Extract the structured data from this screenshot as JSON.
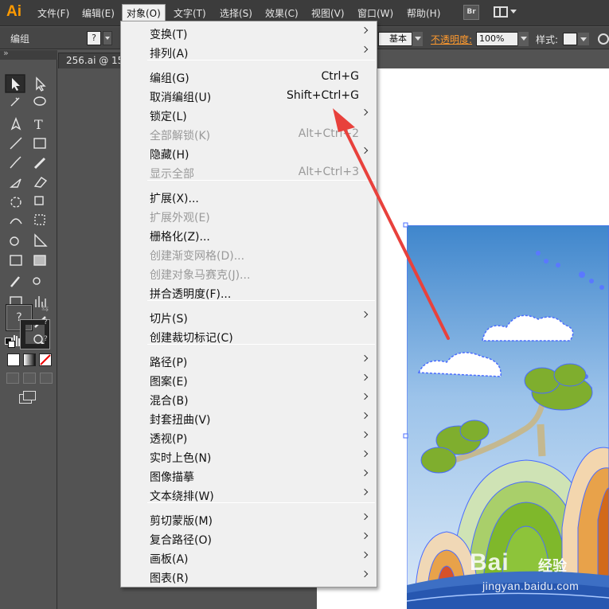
{
  "app": {
    "logo": "Ai"
  },
  "menubar": {
    "items": [
      {
        "label": "文件(F)"
      },
      {
        "label": "编辑(E)"
      },
      {
        "label": "对象(O)"
      },
      {
        "label": "文字(T)"
      },
      {
        "label": "选择(S)"
      },
      {
        "label": "效果(C)"
      },
      {
        "label": "视图(V)"
      },
      {
        "label": "窗口(W)"
      },
      {
        "label": "帮助(H)"
      }
    ],
    "bridge_label": "Br",
    "active_menu": "对象(O)"
  },
  "controlbar": {
    "selection_label": "编组",
    "fill_indicator": "?",
    "stroke_profile": "基本",
    "opacity_label": "不透明度:",
    "opacity_value": "100%",
    "style_label": "样式:"
  },
  "document": {
    "tab_label": "256.ai @ 15"
  },
  "tools": {
    "fill_unknown": "?",
    "stroke_unknown_1": "?",
    "stroke_unknown_2": "?"
  },
  "object_menu": {
    "items": [
      {
        "label": "变换(T)",
        "shortcut": "",
        "submenu": true,
        "disabled": false
      },
      {
        "label": "排列(A)",
        "shortcut": "",
        "submenu": true,
        "disabled": false
      },
      {
        "label": "编组(G)",
        "shortcut": "Ctrl+G",
        "submenu": false,
        "disabled": false
      },
      {
        "label": "取消编组(U)",
        "shortcut": "Shift+Ctrl+G",
        "submenu": false,
        "disabled": false
      },
      {
        "label": "锁定(L)",
        "shortcut": "",
        "submenu": true,
        "disabled": false
      },
      {
        "label": "全部解锁(K)",
        "shortcut": "Alt+Ctrl+2",
        "submenu": false,
        "disabled": true
      },
      {
        "label": "隐藏(H)",
        "shortcut": "",
        "submenu": true,
        "disabled": false
      },
      {
        "label": "显示全部",
        "shortcut": "Alt+Ctrl+3",
        "submenu": false,
        "disabled": true
      },
      {
        "label": "扩展(X)...",
        "shortcut": "",
        "submenu": false,
        "disabled": false
      },
      {
        "label": "扩展外观(E)",
        "shortcut": "",
        "submenu": false,
        "disabled": true
      },
      {
        "label": "栅格化(Z)...",
        "shortcut": "",
        "submenu": false,
        "disabled": false
      },
      {
        "label": "创建渐变网格(D)...",
        "shortcut": "",
        "submenu": false,
        "disabled": true
      },
      {
        "label": "创建对象马赛克(J)...",
        "shortcut": "",
        "submenu": false,
        "disabled": true
      },
      {
        "label": "拼合透明度(F)...",
        "shortcut": "",
        "submenu": false,
        "disabled": false
      },
      {
        "label": "切片(S)",
        "shortcut": "",
        "submenu": true,
        "disabled": false
      },
      {
        "label": "创建裁切标记(C)",
        "shortcut": "",
        "submenu": false,
        "disabled": false
      },
      {
        "label": "路径(P)",
        "shortcut": "",
        "submenu": true,
        "disabled": false
      },
      {
        "label": "图案(E)",
        "shortcut": "",
        "submenu": true,
        "disabled": false
      },
      {
        "label": "混合(B)",
        "shortcut": "",
        "submenu": true,
        "disabled": false
      },
      {
        "label": "封套扭曲(V)",
        "shortcut": "",
        "submenu": true,
        "disabled": false
      },
      {
        "label": "透视(P)",
        "shortcut": "",
        "submenu": true,
        "disabled": false
      },
      {
        "label": "实时上色(N)",
        "shortcut": "",
        "submenu": true,
        "disabled": false
      },
      {
        "label": "图像描摹",
        "shortcut": "",
        "submenu": true,
        "disabled": false
      },
      {
        "label": "文本绕排(W)",
        "shortcut": "",
        "submenu": true,
        "disabled": false
      },
      {
        "label": "剪切蒙版(M)",
        "shortcut": "",
        "submenu": true,
        "disabled": false
      },
      {
        "label": "复合路径(O)",
        "shortcut": "",
        "submenu": true,
        "disabled": false
      },
      {
        "label": "画板(A)",
        "shortcut": "",
        "submenu": true,
        "disabled": false
      },
      {
        "label": "图表(R)",
        "shortcut": "",
        "submenu": true,
        "disabled": false
      }
    ]
  },
  "watermark": {
    "logo": "Bai",
    "logo_cn": "经验",
    "url": "jingyan.baidu.com"
  },
  "colors": {
    "app_accent": "#ff9a00",
    "annotation_arrow": "#e8413c",
    "selection_blue": "#4a6cff",
    "sky_top": "#3f86cc",
    "sky_bottom": "#dbe9f7"
  }
}
